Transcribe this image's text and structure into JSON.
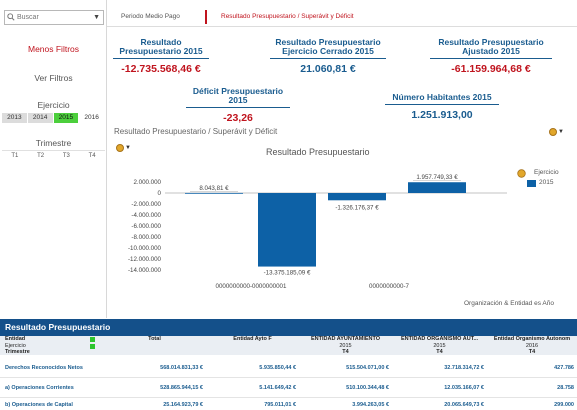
{
  "sidebar": {
    "search_placeholder": "Buscar",
    "less_filters": "Menos Filtros",
    "see_filters": "Ver Filtros",
    "ejercicio_title": "Ejercicio",
    "years": [
      "2013",
      "2014",
      "2015",
      "2016"
    ],
    "selected_year": "2015",
    "trimestre_title": "Trimestre",
    "quarters": [
      "T1",
      "T2",
      "T3",
      "T4"
    ]
  },
  "tabs": {
    "period": "Periodo Medio Pago",
    "result": "Resultado Presupuestario / Superávit y Déficit"
  },
  "kpis": {
    "k1": {
      "title": "Resultado Presupuestario 2015",
      "value": "-12.735.568,46 €"
    },
    "k2": {
      "title": "Resultado Presupuestario Ejercicio Cerrado 2015",
      "value": "21.060,81 €"
    },
    "k3": {
      "title": "Resultado Presupuestario Ajustado 2015",
      "value": "-61.159.964,68 €"
    },
    "k4": {
      "title": "Déficit Presupuestario 2015",
      "value": "-23,26"
    },
    "k5": {
      "title": "Número Habitantes 2015",
      "value": "1.251.913,00"
    }
  },
  "section_title": "Resultado Presupuestario / Superávit y Déficit",
  "chart_data": {
    "type": "bar",
    "title": "Resultado Presupuestario",
    "categories": [
      "0000000000-0000000001",
      "",
      "0000000000-7",
      ""
    ],
    "tick_labels": [
      "0000000000-0000000001",
      "0000000000-7"
    ],
    "series": [
      {
        "name": "2015",
        "values": [
          8043.81,
          -13375185.09,
          -1326176.37,
          1957749.33
        ]
      }
    ],
    "data_labels": [
      "8.043,81 €",
      "-13.375.185,09 €",
      "-1.326.176,37 €",
      "1.957.749,33 €"
    ],
    "yticks": [
      "2.000.000",
      "0",
      "-2.000.000",
      "-4.000.000",
      "-6.000.000",
      "-8.000.000",
      "-10.000.000",
      "-12.000.000",
      "-14.000.000"
    ],
    "ylim": [
      -14000000,
      2000000
    ],
    "legend_title": "Ejercicio",
    "legend_position": "top-right",
    "footer": "Organización & Entidad es Año",
    "bar_color": "#0d61a6"
  },
  "table": {
    "title": "Resultado Presupuestario",
    "dim_labels": [
      "Entidad",
      "Ejercicio",
      "Trimestre"
    ],
    "total_header": "Total",
    "columns": [
      {
        "name": "Entidad Ayto F",
        "year": "",
        "quarter": ""
      },
      {
        "name": "ENTIDAD AYUNTAMIENTO",
        "year": "2015",
        "quarter": "T4"
      },
      {
        "name": "ENTIDAD ORGANISMO AUT...",
        "year": "2015",
        "quarter": "T4"
      },
      {
        "name": "Entidad Organismo Autonom",
        "year": "2016",
        "quarter": "T4"
      }
    ],
    "rows": [
      {
        "label": "Derechos Reconocidos Netos",
        "total": "568.014.831,33 €",
        "values": [
          "5.935.850,44 €",
          "515.504.071,00 €",
          "32.718.314,72 €",
          "427.786"
        ]
      },
      {
        "label": "a) Operaciones Corrientes",
        "total": "528.865.944,15 €",
        "values": [
          "5.141.649,42 €",
          "510.100.344,48 €",
          "12.035.166,07 €",
          "28.758"
        ]
      },
      {
        "label": "b) Operaciones de Capital",
        "total": "25.164.923,79 €",
        "values": [
          "795.011,01 €",
          "3.994.263,05 €",
          "20.065.649,73 €",
          "299.000"
        ]
      }
    ]
  },
  "colors": {
    "accent_red": "#c0141e",
    "kpi_blue": "#1a5c8f",
    "bar_blue": "#0d61a6",
    "table_header": "#14508a",
    "selected_green": "#4ccf3c"
  }
}
